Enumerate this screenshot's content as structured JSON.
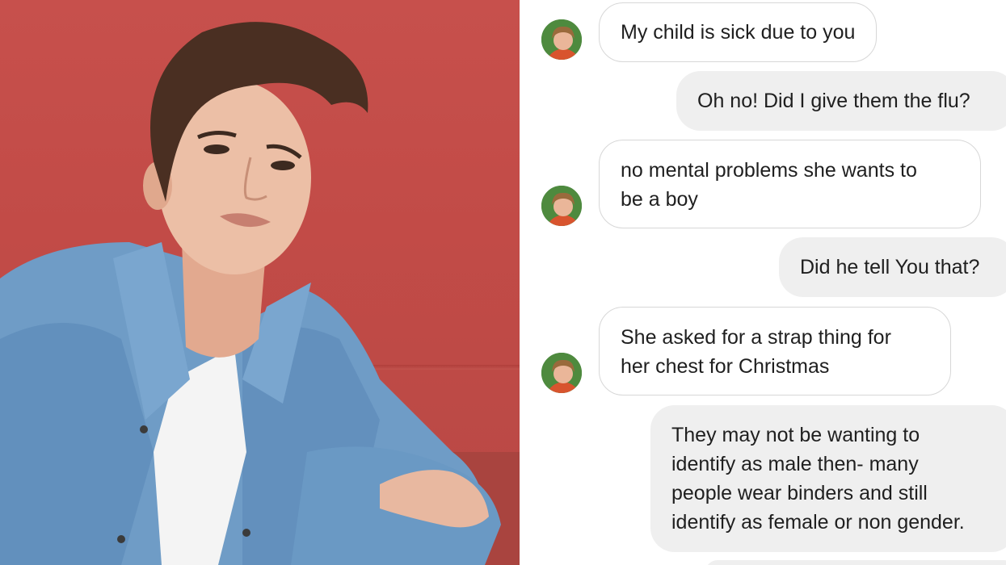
{
  "photo": {
    "description_icon": "person-photo"
  },
  "chat": {
    "messages": [
      {
        "sender": "other",
        "lines": [
          "My child is sick due to you"
        ]
      },
      {
        "sender": "me",
        "lines": [
          "Oh no! Did I give them the flu?"
        ]
      },
      {
        "sender": "other",
        "lines": [
          "no mental problems she wants to",
          "be a boy"
        ]
      },
      {
        "sender": "me",
        "lines": [
          "Did he tell You that?"
        ]
      },
      {
        "sender": "other",
        "lines": [
          "She asked for a strap thing for",
          "her chest for Christmas"
        ]
      },
      {
        "sender": "me",
        "lines": [
          "They may not be wanting to",
          "identify as male then- many",
          "people wear binders and still",
          "identify as female or non gender."
        ]
      }
    ]
  },
  "colors": {
    "wall": "#c24b47",
    "incoming_bubble_border": "#d7d7d7",
    "outgoing_bubble": "#efefef",
    "text": "#1f1f1f"
  }
}
